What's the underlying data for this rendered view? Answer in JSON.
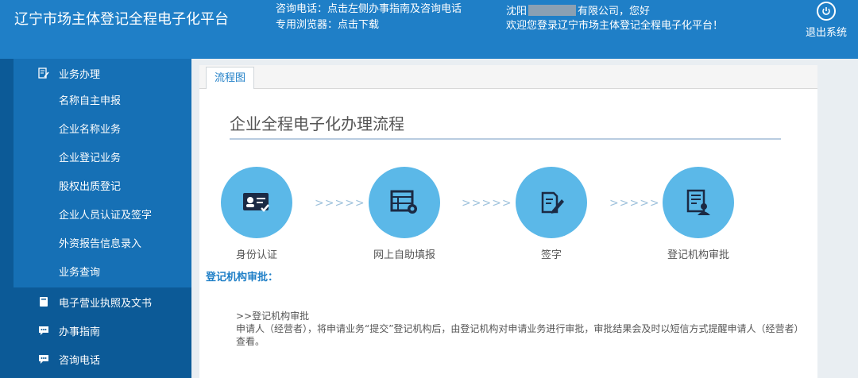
{
  "header": {
    "app_title": "辽宁市场主体登记全程电子化平台",
    "contact_line1": "咨询电话：点击左侧办事指南及咨询电话",
    "contact_line2": "专用浏览器：点击下载",
    "user_prefix": "沈阳",
    "user_suffix": "有限公司，您好",
    "welcome": "欢迎您登录辽宁市场主体登记全程电子化平台！",
    "logout": "退出系统"
  },
  "sidebar": {
    "group_business": "业务办理",
    "items": [
      "名称自主申报",
      "企业名称业务",
      "企业登记业务",
      "股权出质登记",
      "企业人员认证及签字",
      "外资报告信息录入",
      "业务查询"
    ],
    "group_license": "电子营业执照及文书",
    "group_guide": "办事指南",
    "group_phone": "咨询电话"
  },
  "main": {
    "tab": "流程图",
    "title": "企业全程电子化办理流程",
    "steps": [
      {
        "label": "身份认证",
        "icon": "id-card-icon"
      },
      {
        "label": "网上自助填报",
        "icon": "form-gear-icon"
      },
      {
        "label": "签字",
        "icon": "sign-pen-icon"
      },
      {
        "label": "登记机构审批",
        "icon": "approval-doc-icon"
      }
    ],
    "arrow": ">>>>>",
    "section_title": "登记机构审批：",
    "desc_head": ">>登记机构审批",
    "desc_body": "申请人（经营者），将申请业务“提交”登记机构后，由登记机构对申请业务进行审批，审批结果会及时以短信方式提醒申请人（经营者）查看。"
  },
  "colors": {
    "header_bg": "#1f7fc7",
    "sidebar_bg": "#0c5a97",
    "step_circle": "#5bb8e8"
  }
}
